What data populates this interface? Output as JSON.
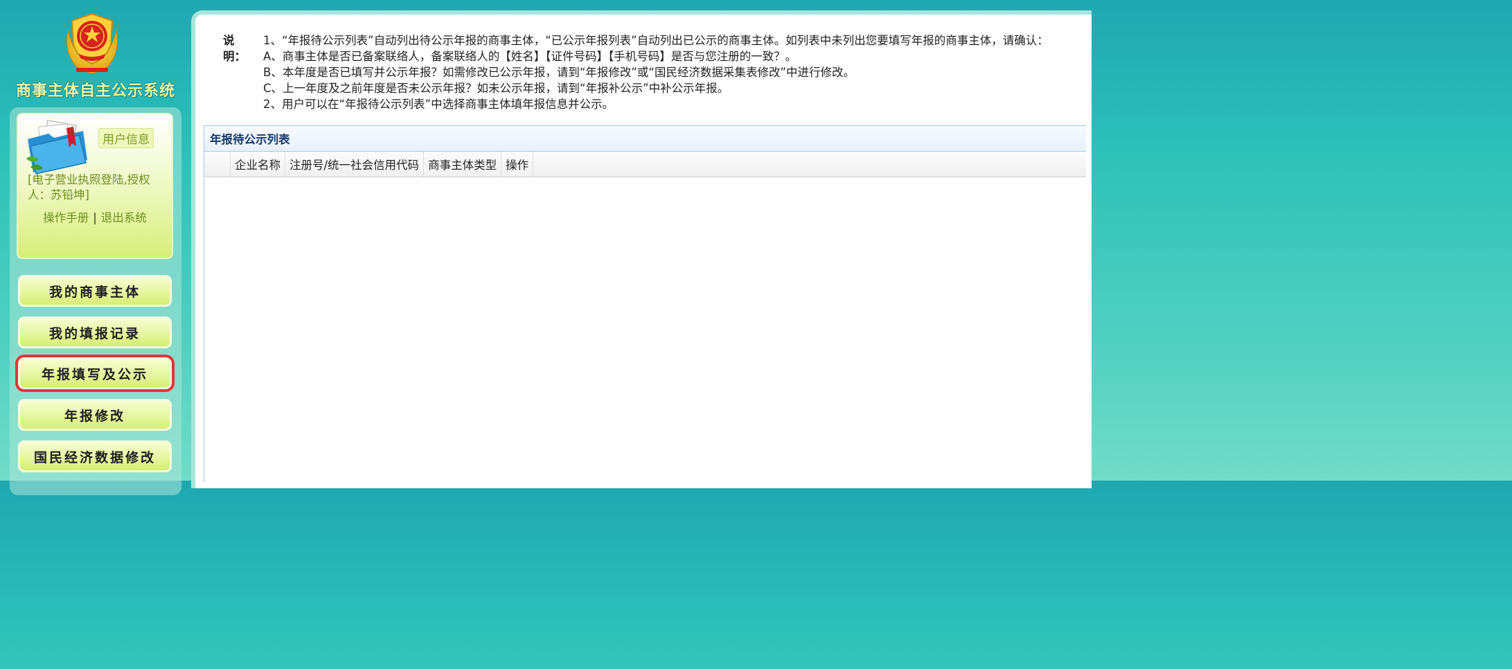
{
  "sidebar": {
    "system_title": "商事主体自主公示系统",
    "user_card": {
      "tag": "用户信息",
      "name_line": "[电子营业执照登陆,授权人：苏铅坤]",
      "manual_link": "操作手册",
      "separator": "|",
      "logout_link": "退出系统"
    },
    "nav": [
      {
        "label": "我的商事主体"
      },
      {
        "label": "我的填报记录"
      },
      {
        "label": "年报填写及公示",
        "highlighted": true
      },
      {
        "label": "年报修改"
      },
      {
        "label": "国民经济数据修改"
      }
    ]
  },
  "notes": {
    "label": "说明：",
    "lines": [
      "1、“年报待公示列表”自动列出待公示年报的商事主体，“已公示年报列表”自动列出已公示的商事主体。如列表中未列出您要填写年报的商事主体，请确认：",
      "A、商事主体是否已备案联络人，备案联络人的【姓名】【证件号码】【手机号码】是否与您注册的一致？。",
      "B、本年度是否已填写并公示年报？如需修改已公示年报，请到“年报修改”或“国民经济数据采集表修改”中进行修改。",
      "C、上一年度及之前年度是否未公示年报？如未公示年报，请到“年报补公示”中补公示年报。",
      "2、用户可以在“年报待公示列表”中选择商事主体填年报信息并公示。"
    ]
  },
  "list": {
    "title": "年报待公示列表",
    "columns": [
      "企业名称",
      "注册号/统一社会信用代码",
      "商事主体类型",
      "操作"
    ],
    "rows": []
  },
  "colors": {
    "background": "#1fa7b0",
    "nav_button": "#e6f6a0",
    "highlight_outline": "#e8333a",
    "title_text": "#f0f8a0",
    "list_title_text": "#15386a"
  },
  "icons": [
    "national-emblem-icon",
    "folder-icon"
  ]
}
